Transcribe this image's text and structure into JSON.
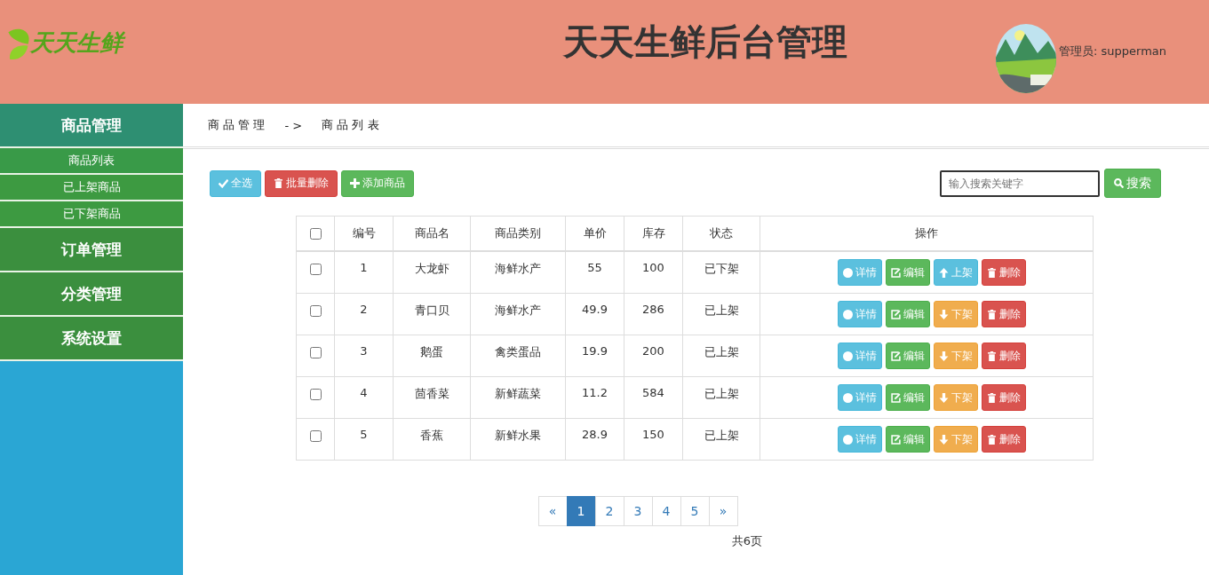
{
  "header": {
    "logo_text": "天天生鲜",
    "title": "天天生鲜后台管理",
    "user": "管理员: supperman"
  },
  "sidebar": [
    {
      "label": "商品管理",
      "expanded": true,
      "children": [
        {
          "label": "商品列表",
          "selected": true
        },
        {
          "label": "已上架商品",
          "selected": false
        },
        {
          "label": "已下架商品",
          "selected": false
        }
      ]
    },
    {
      "label": "订单管理",
      "expanded": false
    },
    {
      "label": "分类管理",
      "expanded": false
    },
    {
      "label": "系统设置",
      "expanded": false
    }
  ],
  "breadcrumb": [
    "商 品 管 理",
    "- >",
    "商 品 列 表"
  ],
  "toolbar": [
    {
      "kind": "select_all",
      "label": "全选"
    },
    {
      "kind": "batch_delete",
      "label": "批量删除"
    },
    {
      "kind": "add",
      "label": "添加商品"
    }
  ],
  "search": {
    "placeholder": "输入搜索关键字",
    "button": "搜索"
  },
  "table": {
    "all_checked": false,
    "columns": [
      "编号",
      "商品名",
      "商品类别",
      "单价",
      "库存",
      "状态",
      "操作"
    ],
    "rows": [
      {
        "checked": false,
        "cells": [
          "1",
          "大龙虾",
          "海鲜水产",
          "55",
          "100",
          "已下架"
        ],
        "actions": [
          {
            "kind": "detail",
            "label": "详情"
          },
          {
            "kind": "edit",
            "label": "编辑"
          },
          {
            "kind": "shelve_up",
            "label": "上架"
          },
          {
            "kind": "delete",
            "label": "删除"
          }
        ]
      },
      {
        "checked": false,
        "cells": [
          "2",
          "青口贝",
          "海鲜水产",
          "49.9",
          "286",
          "已上架"
        ],
        "actions": [
          {
            "kind": "detail",
            "label": "详情"
          },
          {
            "kind": "edit",
            "label": "编辑"
          },
          {
            "kind": "shelve_down",
            "label": "下架"
          },
          {
            "kind": "delete",
            "label": "删除"
          }
        ]
      },
      {
        "checked": false,
        "cells": [
          "3",
          "鹅蛋",
          "禽类蛋品",
          "19.9",
          "200",
          "已上架"
        ],
        "actions": [
          {
            "kind": "detail",
            "label": "详情"
          },
          {
            "kind": "edit",
            "label": "编辑"
          },
          {
            "kind": "shelve_down",
            "label": "下架"
          },
          {
            "kind": "delete",
            "label": "删除"
          }
        ]
      },
      {
        "checked": false,
        "cells": [
          "4",
          "茴香菜",
          "新鲜蔬菜",
          "11.2",
          "584",
          "已上架"
        ],
        "actions": [
          {
            "kind": "detail",
            "label": "详情"
          },
          {
            "kind": "edit",
            "label": "编辑"
          },
          {
            "kind": "shelve_down",
            "label": "下架"
          },
          {
            "kind": "delete",
            "label": "删除"
          }
        ]
      },
      {
        "checked": false,
        "cells": [
          "5",
          "香蕉",
          "新鲜水果",
          "28.9",
          "150",
          "已上架"
        ],
        "actions": [
          {
            "kind": "detail",
            "label": "详情"
          },
          {
            "kind": "edit",
            "label": "编辑"
          },
          {
            "kind": "shelve_down",
            "label": "下架"
          },
          {
            "kind": "delete",
            "label": "删除"
          }
        ]
      }
    ]
  },
  "pagination": {
    "prev": "«",
    "next": "»",
    "pages": [
      {
        "label": "1",
        "selected": true
      },
      {
        "label": "2",
        "selected": false
      },
      {
        "label": "3",
        "selected": false
      },
      {
        "label": "4",
        "selected": false
      },
      {
        "label": "5",
        "selected": false
      }
    ],
    "total": "共6页"
  }
}
